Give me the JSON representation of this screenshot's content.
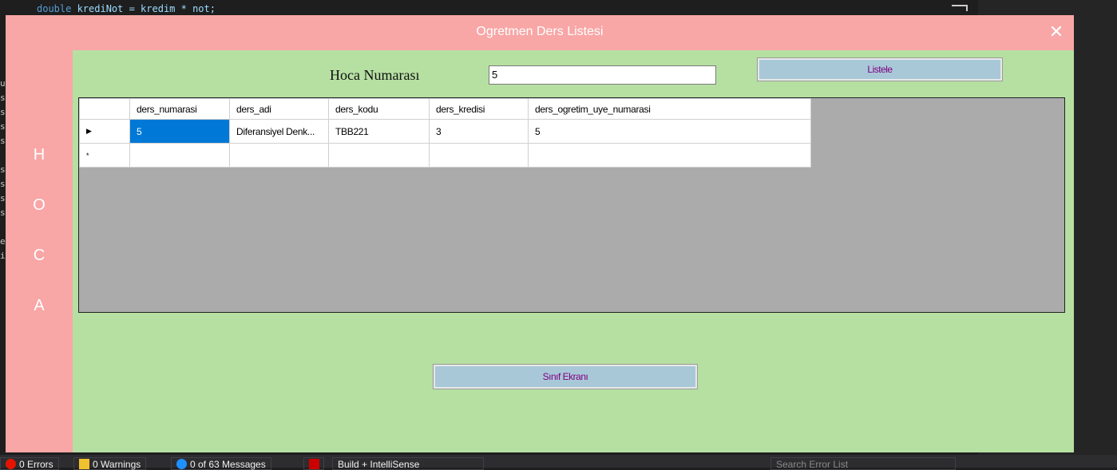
{
  "ide": {
    "code_line_keyword": "double",
    "code_line_rest": " krediNot = kredim * not;",
    "gutter_chars": [
      "u",
      "s",
      "s",
      "s",
      "s",
      "",
      "s",
      "s",
      "s",
      "s",
      "",
      "ef",
      "i"
    ],
    "status": {
      "errors": "0 Errors",
      "warnings": "0 Warnings",
      "messages": "0 of 63 Messages",
      "build": "Build + IntelliSense",
      "search_placeholder": "Search Error List"
    }
  },
  "form": {
    "title": "Ogretmen Ders Listesi",
    "close_glyph": "✕",
    "side_letters": [
      "H",
      "O",
      "C",
      "A"
    ],
    "hoca_label": "Hoca Numarası",
    "hoca_value": "5",
    "listele_label": "Listele",
    "sinif_label": "Sınıf Ekranı",
    "grid": {
      "columns": [
        "ders_numarasi",
        "ders_adi",
        "ders_kodu",
        "ders_kredisi",
        "ders_ogretim_uye_numarasi"
      ],
      "rows": [
        {
          "indicator": "▶",
          "cells": [
            "5",
            "Diferansiyel Denk...",
            "TBB221",
            "3",
            "5"
          ]
        },
        {
          "indicator": "*",
          "cells": [
            "",
            "",
            "",
            "",
            ""
          ]
        }
      ]
    },
    "colors": {
      "window": "#f8a6a6",
      "panel": "#b6e0a2",
      "button": "#a8c8d8",
      "button_text": "#800080",
      "selection": "#0078d7"
    }
  }
}
